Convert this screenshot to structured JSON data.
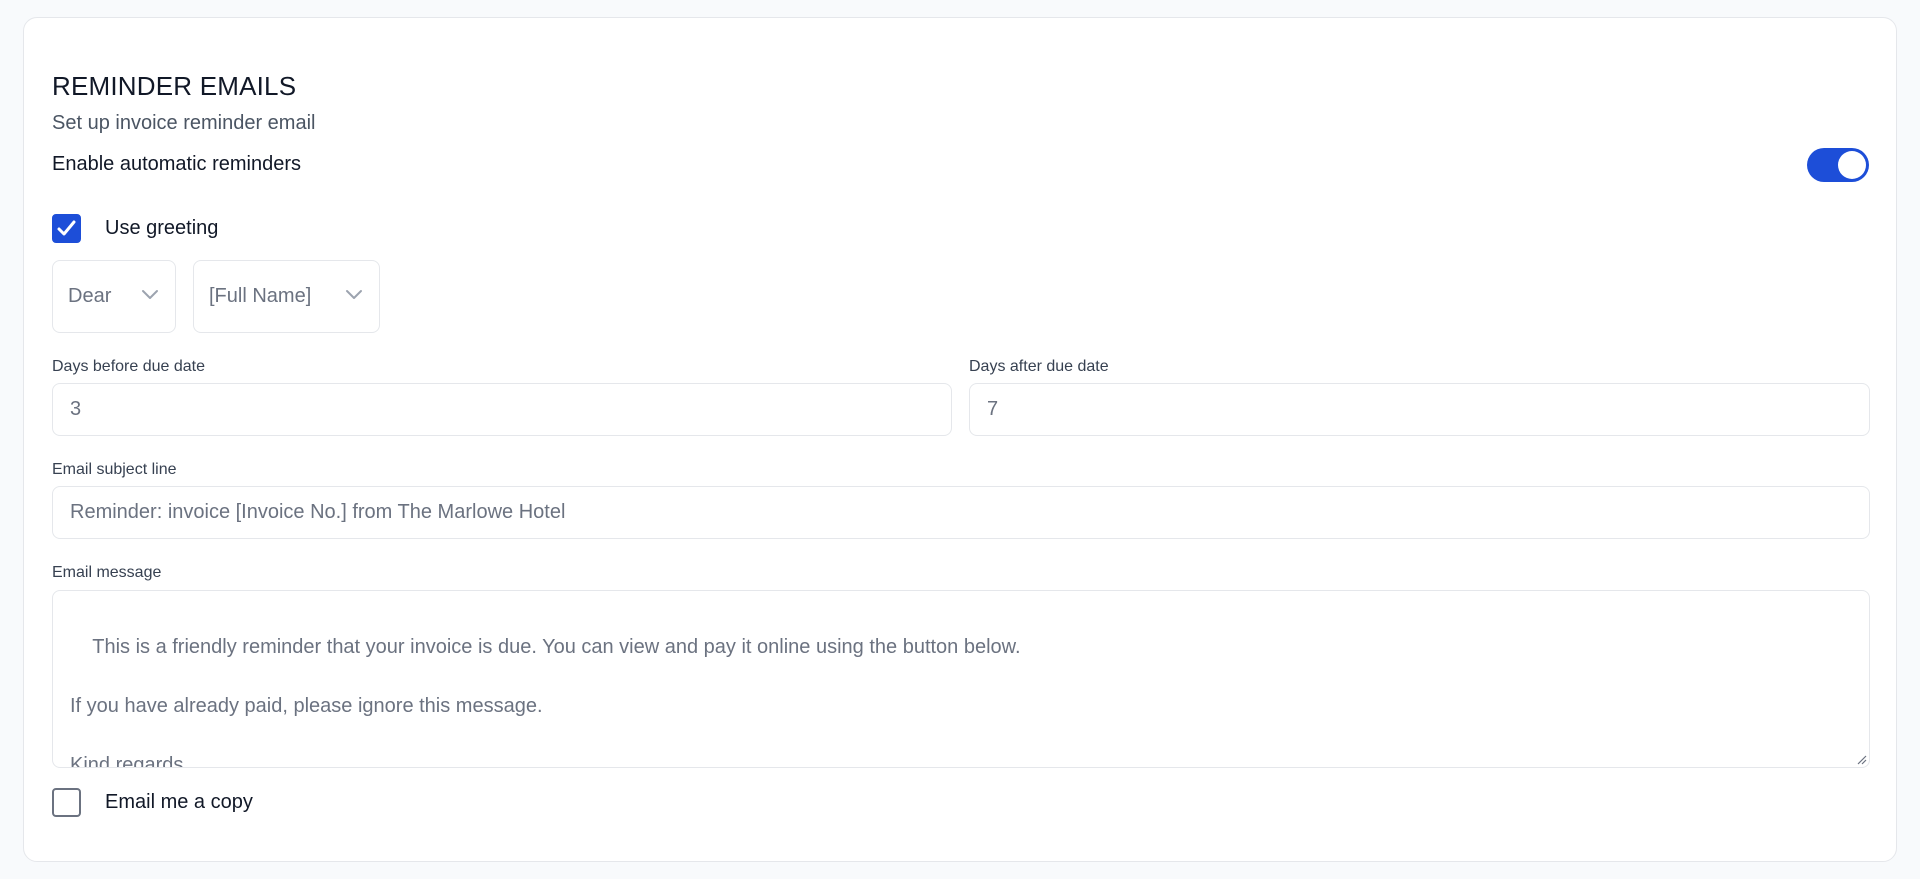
{
  "section": {
    "title": "REMINDER EMAILS",
    "subtitle": "Set up invoice reminder email"
  },
  "auto_reminders": {
    "label": "Enable automatic reminders",
    "enabled": true
  },
  "greeting": {
    "checkbox_label": "Use greeting",
    "checked": true,
    "salutation": "Dear",
    "name_format": "[Full Name]"
  },
  "days_before": {
    "label": "Days before due date",
    "value": "3"
  },
  "days_after": {
    "label": "Days after due date",
    "value": "7"
  },
  "subject": {
    "label": "Email subject line",
    "value": "Reminder: invoice [Invoice No.] from The Marlowe Hotel"
  },
  "message": {
    "label": "Email message",
    "value": "This is a friendly reminder that your invoice is due. You can view and pay it online using the button below.\n\nIf you have already paid, please ignore this message.\n\nKind regards,\nThe Marlowe Hotel"
  },
  "copy_me": {
    "label": "Email me a copy",
    "checked": false
  },
  "colors": {
    "accent": "#1d4ed8",
    "border": "#e5e7eb",
    "text_muted": "#6b7280"
  },
  "icons": {
    "check": "check-icon",
    "chevron": "chevron-down-icon"
  }
}
